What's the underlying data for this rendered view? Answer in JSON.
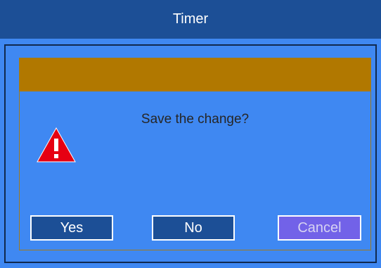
{
  "window": {
    "title": "Timer"
  },
  "dialog": {
    "message": "Save the change?",
    "icon": "warning-icon",
    "buttons": {
      "yes": "Yes",
      "no": "No",
      "cancel": "Cancel"
    }
  },
  "colors": {
    "title_bar": "#1c4f96",
    "background": "#3f88f2",
    "dialog_header": "#b17800",
    "button": "#1c4f96",
    "button_selected": "#7262e8",
    "warning": "#e60012"
  }
}
